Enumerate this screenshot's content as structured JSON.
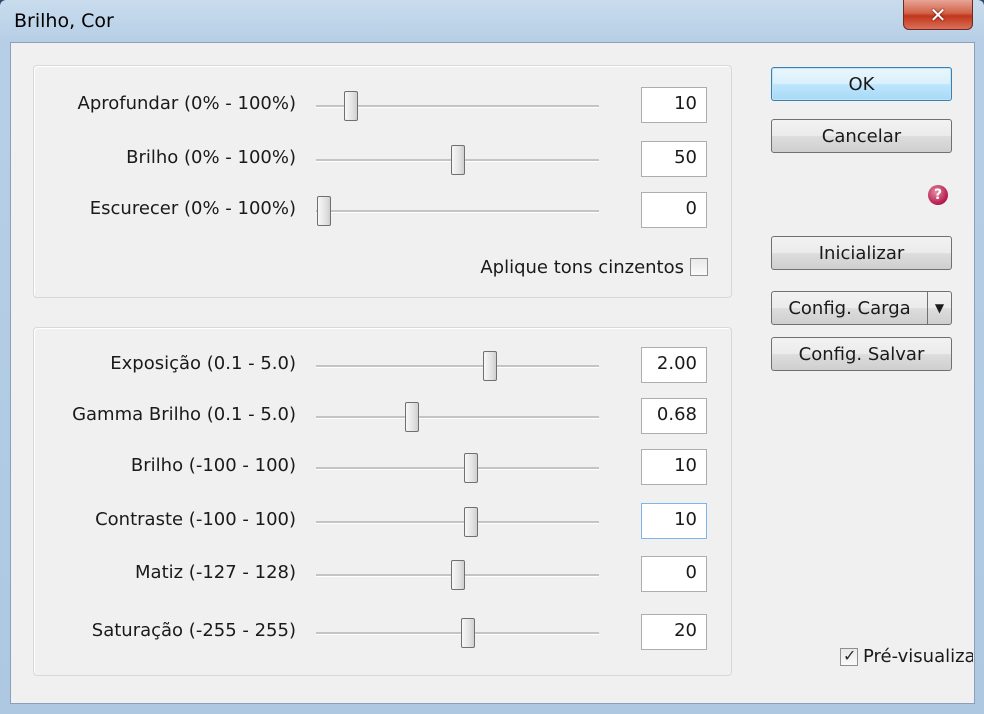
{
  "window": {
    "title": "Brilho, Cor",
    "close_glyph": "✕"
  },
  "group1": {
    "rows": [
      {
        "label": "Aprofundar (0% - 100%)",
        "value": "10",
        "slider_fraction": 0.1
      },
      {
        "label": "Brilho (0% - 100%)",
        "value": "50",
        "slider_fraction": 0.5
      },
      {
        "label": "Escurecer (0% - 100%)",
        "value": "0",
        "slider_fraction": 0.0
      }
    ],
    "grayscale_label": "Aplique tons cinzentos",
    "grayscale_checked": false
  },
  "group2": {
    "rows": [
      {
        "label": "Exposição (0.1 - 5.0)",
        "value": "2.00",
        "slider_fraction": 0.62
      },
      {
        "label": "Gamma Brilho (0.1 - 5.0)",
        "value": "0.68",
        "slider_fraction": 0.33
      },
      {
        "label": "Brilho (-100 - 100)",
        "value": "10",
        "slider_fraction": 0.55
      },
      {
        "label": "Contraste (-100 - 100)",
        "value": "10",
        "slider_fraction": 0.55
      },
      {
        "label": "Matiz (-127 - 128)",
        "value": "0",
        "slider_fraction": 0.5
      },
      {
        "label": "Saturação (-255 - 255)",
        "value": "20",
        "slider_fraction": 0.54
      }
    ]
  },
  "buttons": {
    "ok": "OK",
    "cancel": "Cancelar",
    "help_glyph": "?",
    "reset": "Inicializar",
    "load": "Config. Carga",
    "load_arrow": "▼",
    "save": "Config. Salvar"
  },
  "preview": {
    "label": "Pré-visualiza",
    "checked": true,
    "check_glyph": "✓"
  },
  "colors": {
    "accent": "#3c7fb1",
    "dialog_bg": "#f0f0f0",
    "help_icon": "#b3194a"
  }
}
